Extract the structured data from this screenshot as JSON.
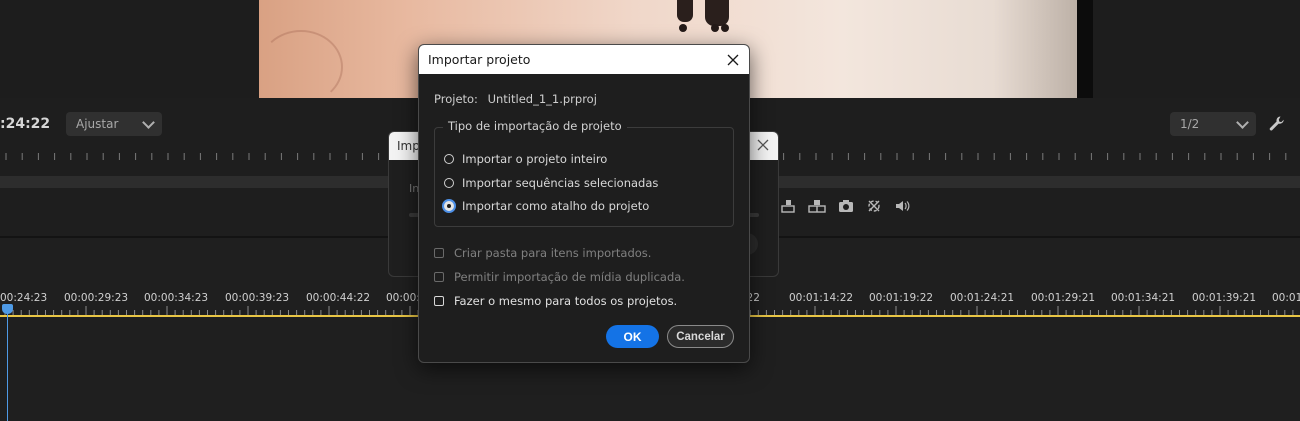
{
  "monitor": {
    "timecode": ":24:22",
    "fit_select": "Ajustar",
    "resolution_select": "1/2"
  },
  "timeline": {
    "labels": [
      {
        "text": "00:24:23",
        "pos": 0
      },
      {
        "text": "00:00:29:23",
        "pos": 1
      },
      {
        "text": "00:00:34:23",
        "pos": 2
      },
      {
        "text": "00:00:39:23",
        "pos": 3
      },
      {
        "text": "00:00:44:22",
        "pos": 4
      },
      {
        "text": "00:00:4",
        "pos": 5
      },
      {
        "text": ":22",
        "pos": 6
      },
      {
        "text": "00:01:14:22",
        "pos": 7
      },
      {
        "text": "00:01:19:22",
        "pos": 8
      },
      {
        "text": "00:01:24:21",
        "pos": 9
      },
      {
        "text": "00:01:29:21",
        "pos": 10
      },
      {
        "text": "00:01:34:21",
        "pos": 11
      },
      {
        "text": "00:01:39:21",
        "pos": 12
      },
      {
        "text": "00:01:4",
        "pos": 13
      }
    ]
  },
  "behind_dialog": {
    "title": "Impo",
    "text": "In"
  },
  "dialog": {
    "title": "Importar projeto",
    "project_label": "Projeto:",
    "project_value": "Untitled_1_1.prproj",
    "group_label": "Tipo de importação de projeto",
    "radios": [
      {
        "label": "Importar o projeto inteiro",
        "checked": false
      },
      {
        "label": "Importar sequências selecionadas",
        "checked": false
      },
      {
        "label": "Importar como atalho do projeto",
        "checked": true
      }
    ],
    "checkboxes": [
      {
        "label": "Criar pasta para itens importados.",
        "enabled": false
      },
      {
        "label": "Permitir importação de mídia duplicada.",
        "enabled": false
      },
      {
        "label": "Fazer o mesmo para todos os projetos.",
        "enabled": true
      }
    ],
    "ok_label": "OK",
    "cancel_label": "Cancelar"
  }
}
